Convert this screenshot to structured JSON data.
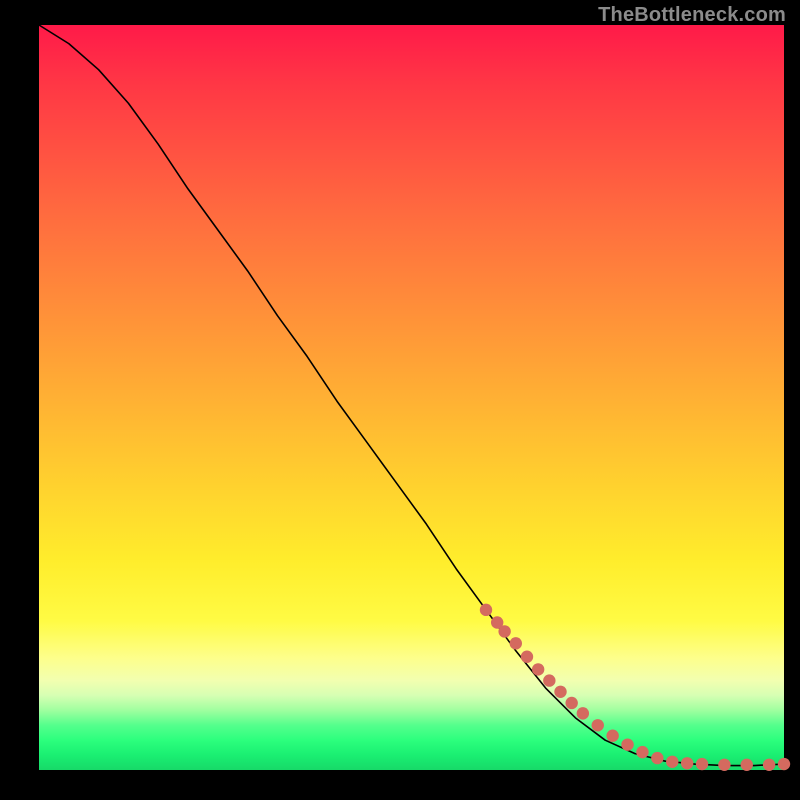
{
  "watermark": "TheBottleneck.com",
  "chart_data": {
    "type": "line",
    "title": "",
    "xlabel": "",
    "ylabel": "",
    "xlim": [
      0,
      100
    ],
    "ylim": [
      0,
      100
    ],
    "grid": false,
    "legend": false,
    "series": [
      {
        "name": "curve",
        "x": [
          0,
          4,
          8,
          12,
          16,
          20,
          24,
          28,
          32,
          36,
          40,
          44,
          48,
          52,
          56,
          60,
          64,
          68,
          72,
          76,
          80,
          84,
          88,
          92,
          96,
          100
        ],
        "y": [
          100,
          97.5,
          94.0,
          89.5,
          84.0,
          78.0,
          72.5,
          67.0,
          61.0,
          55.5,
          49.5,
          44.0,
          38.5,
          33.0,
          27.0,
          21.5,
          16.0,
          11.0,
          7.0,
          4.0,
          2.2,
          1.2,
          0.8,
          0.6,
          0.6,
          0.8
        ]
      }
    ],
    "points": {
      "name": "markers",
      "color": "#d46a5f",
      "x": [
        60,
        61.5,
        62.5,
        64,
        65.5,
        67,
        68.5,
        70,
        71.5,
        73,
        75,
        77,
        79,
        81,
        83,
        85,
        87,
        89,
        92,
        95,
        98,
        100
      ],
      "y": [
        21.5,
        19.8,
        18.6,
        17.0,
        15.2,
        13.5,
        12.0,
        10.5,
        9.0,
        7.6,
        6.0,
        4.6,
        3.4,
        2.4,
        1.6,
        1.1,
        0.9,
        0.8,
        0.7,
        0.7,
        0.7,
        0.8
      ]
    }
  }
}
